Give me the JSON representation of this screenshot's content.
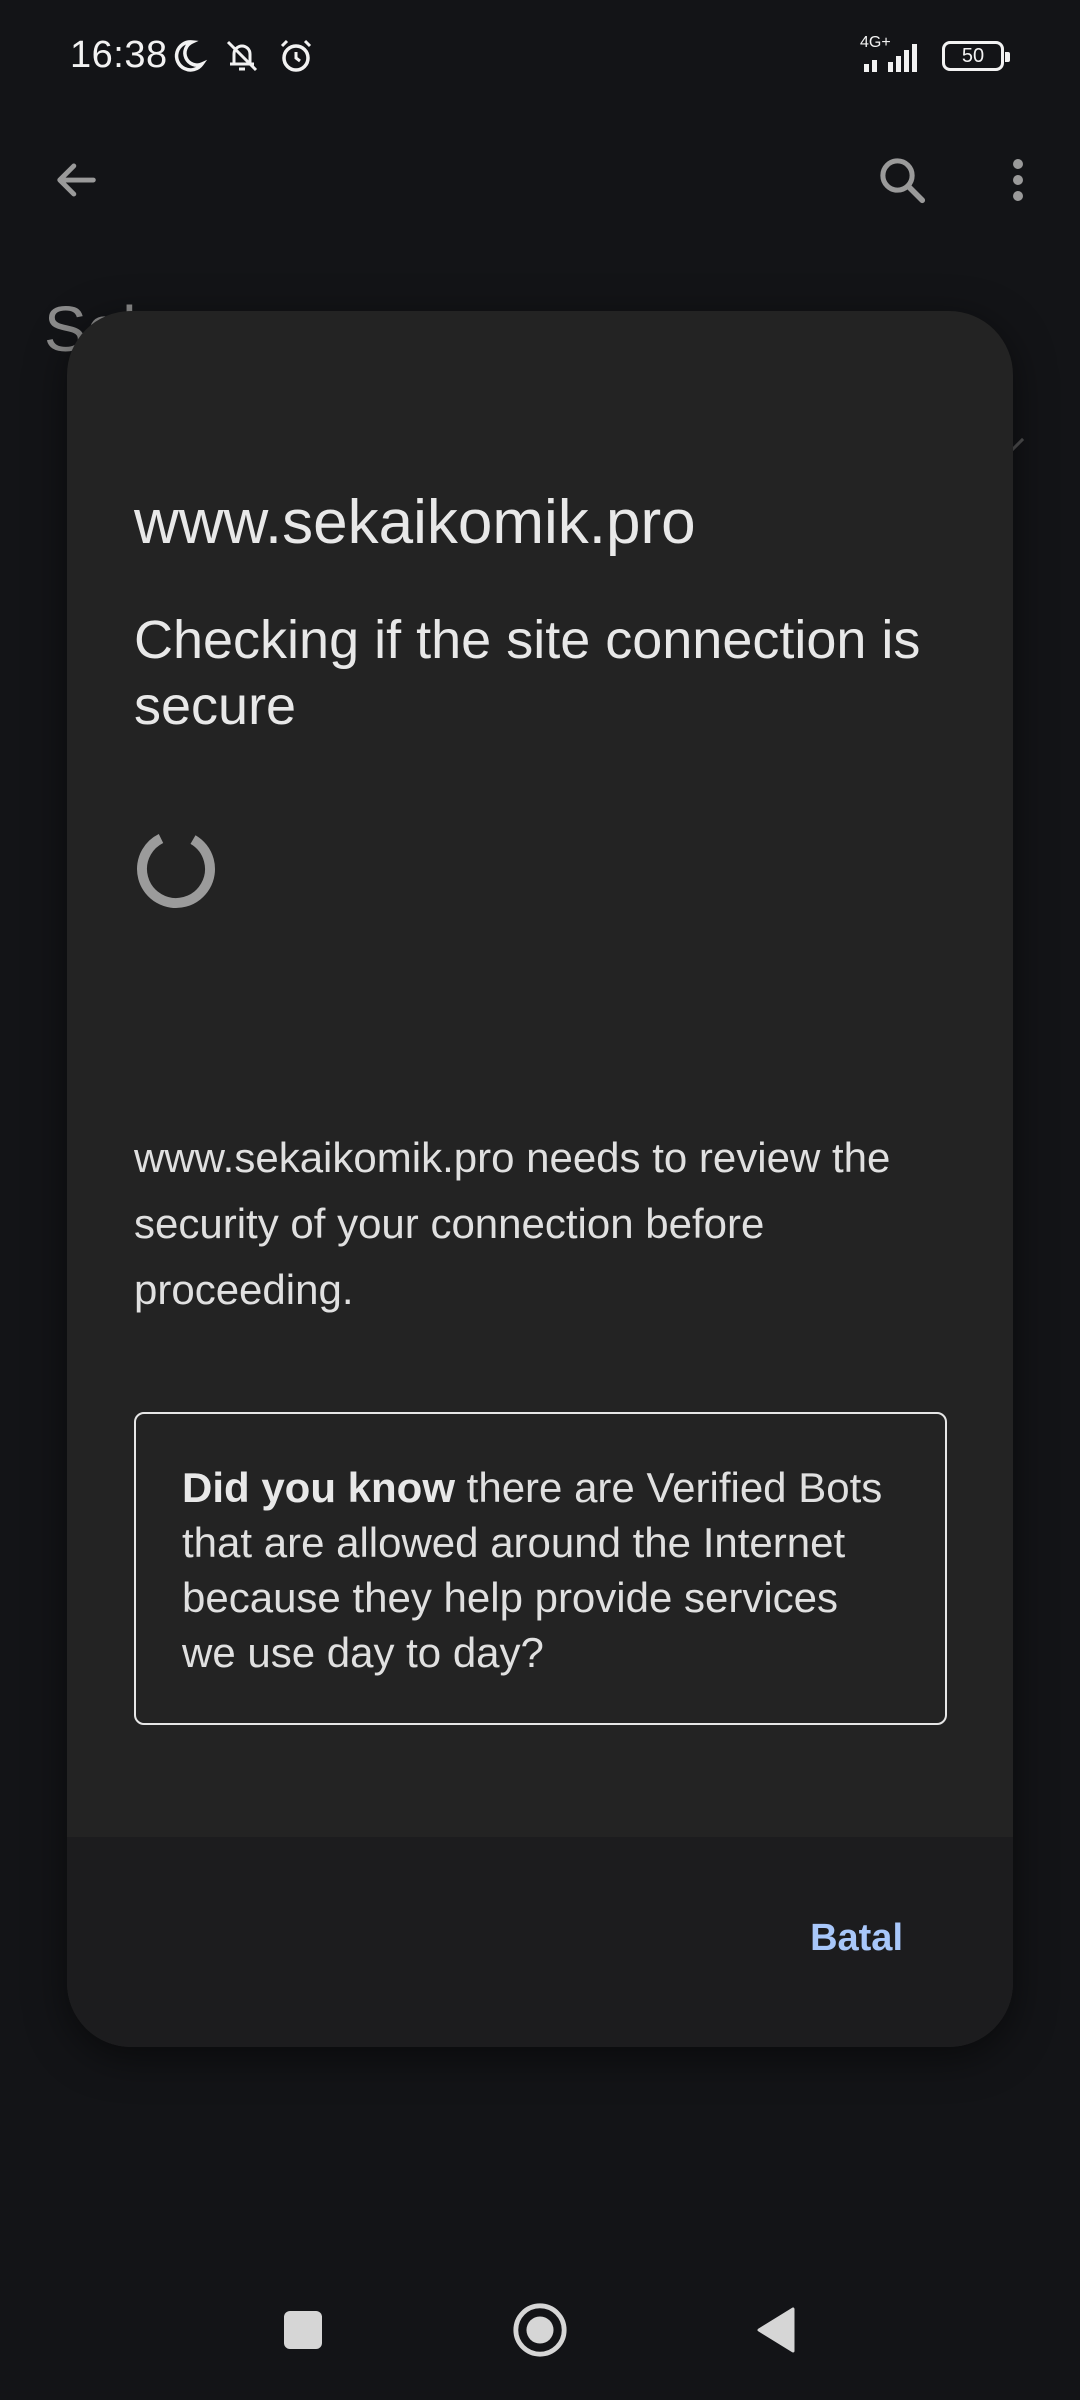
{
  "status_bar": {
    "time": "16:38",
    "network": "4G+",
    "battery": "50",
    "icons": [
      "moon-icon",
      "notifications-off-icon",
      "alarm-icon",
      "signal-icon",
      "battery-icon"
    ]
  },
  "app_bar": {
    "back_icon": "arrow-back-icon",
    "search_icon": "search-icon",
    "menu_icon": "more-vertical-icon",
    "background_title": "Sel..."
  },
  "dialog": {
    "site": "www.sekaikomik.pro",
    "heading": "Checking if the site connection is secure",
    "message": "www.sekaikomik.pro needs to review the security of your connection before proceeding.",
    "did_you_know": {
      "bold": "Did you know",
      "text": " there are Verified Bots that are allowed around the Internet because they help provide services we use day to day?"
    },
    "cancel_label": "Batal"
  },
  "nav_bar": {
    "icons": [
      "recents-square-icon",
      "home-circle-icon",
      "back-triangle-icon"
    ]
  },
  "colors": {
    "background": "#131417",
    "dialog": "#232323",
    "accent": "#a8c7fa"
  }
}
